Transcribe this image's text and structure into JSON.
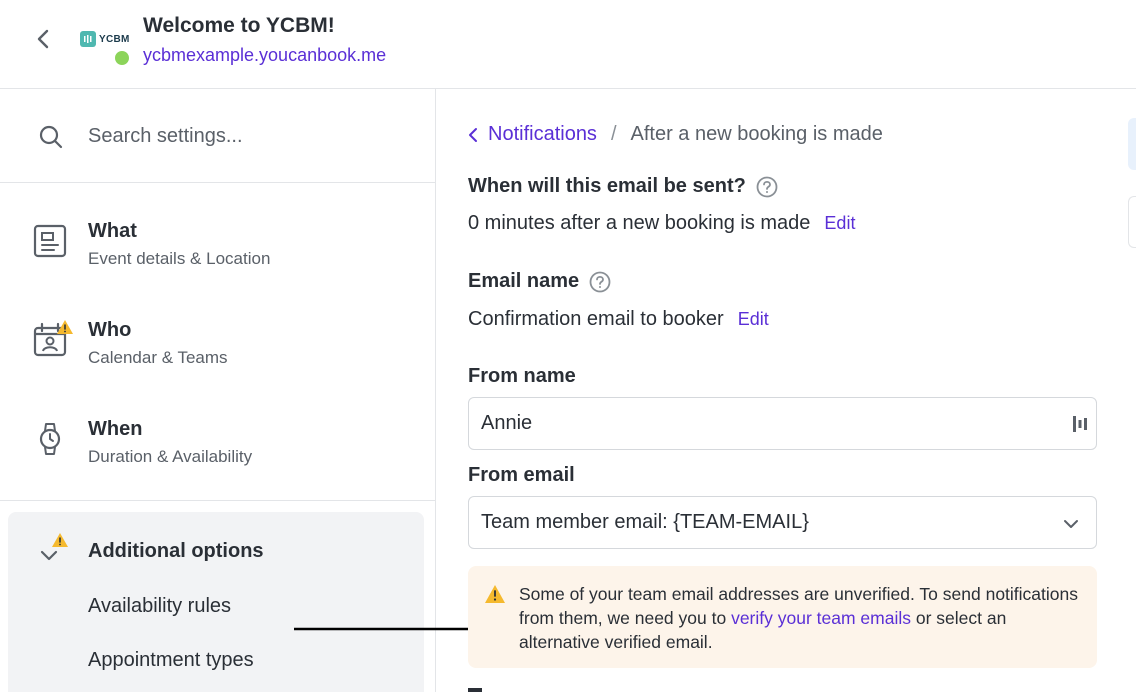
{
  "header": {
    "title": "Welcome to YCBM!",
    "url": "ycbmexample.youcanbook.me",
    "logo_text": "YCBM",
    "status_color": "#8cd45a"
  },
  "sidebar": {
    "search": {
      "placeholder": "Search settings..."
    },
    "items": [
      {
        "title": "What",
        "subtitle": "Event details & Location",
        "icon": "document-icon",
        "warning": false
      },
      {
        "title": "Who",
        "subtitle": "Calendar & Teams",
        "icon": "calendar-person-icon",
        "warning": true
      },
      {
        "title": "When",
        "subtitle": "Duration & Availability",
        "icon": "watch-icon",
        "warning": false
      }
    ],
    "additional": {
      "title": "Additional options",
      "warning": true,
      "subitems": [
        "Availability rules",
        "Appointment types"
      ]
    }
  },
  "main": {
    "breadcrumb": {
      "parent": "Notifications",
      "separator": "/",
      "current": "After a new booking is made"
    },
    "send_time": {
      "label": "When will this email be sent?",
      "value": "0 minutes after a new booking is made",
      "edit": "Edit"
    },
    "email_name": {
      "label": "Email name",
      "value": "Confirmation email to booker",
      "edit": "Edit"
    },
    "from_name": {
      "label": "From name",
      "value": "Annie"
    },
    "from_email": {
      "label": "From email",
      "selected": "Team member email: {TEAM-EMAIL}"
    },
    "alert": {
      "text_before": "Some of your team email addresses are unverified. To send notifications from them, we need you to ",
      "link": "verify your team emails",
      "text_after": " or select an alternative verified email."
    }
  },
  "colors": {
    "accent": "#5a2fd6",
    "warning": "#f5b92e",
    "alert_bg": "#fdf4ea"
  }
}
